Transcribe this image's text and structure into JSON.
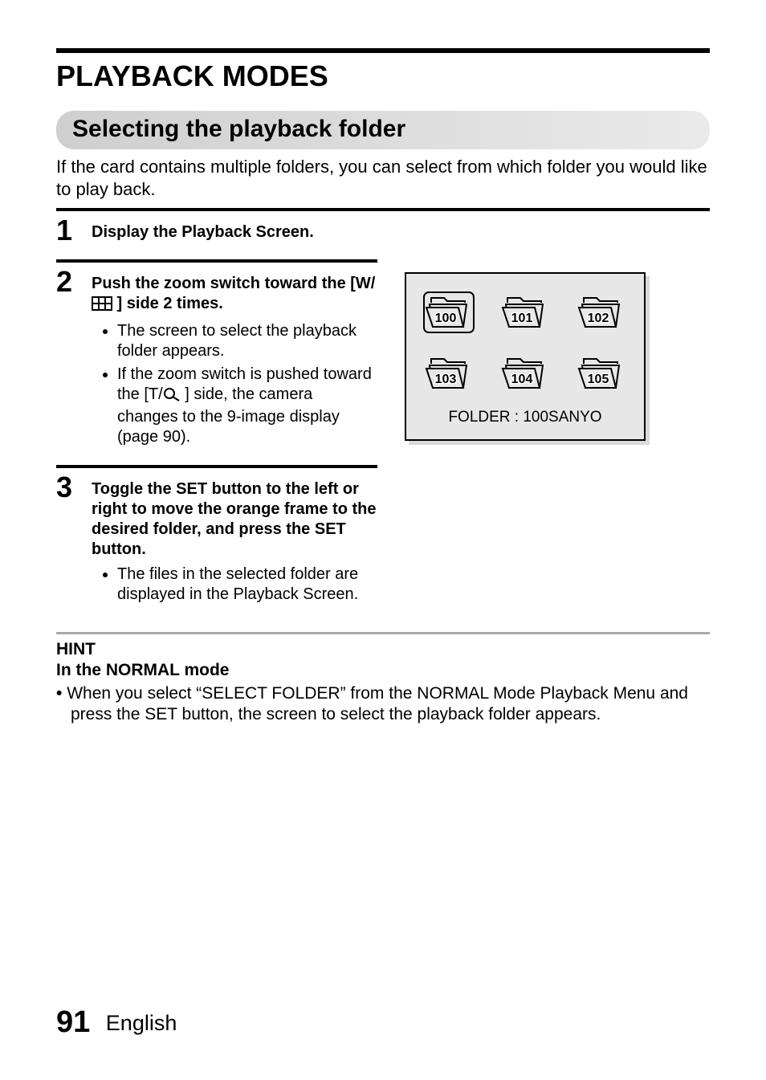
{
  "title": "PLAYBACK MODES",
  "section_heading": "Selecting the playback folder",
  "intro": "If the card contains multiple folders, you can select from which folder you would like to play back.",
  "steps": [
    {
      "num": "1",
      "head": "Display the Playback Screen."
    },
    {
      "num": "2",
      "head_pre": "Push the zoom switch toward the [W/",
      "head_post": " ] side 2 times.",
      "bullets": [
        "The screen to select the playback folder appears.",
        ""
      ],
      "bullet2_pre": "If the zoom switch is pushed toward the [T/",
      "bullet2_post": " ] side, the camera changes to the 9-image display (page 90)."
    },
    {
      "num": "3",
      "head": "Toggle the SET button to the left or right to move the orange frame to the desired folder, and press the SET button.",
      "bullets": [
        "The files in the selected folder are displayed in the Playback Screen."
      ]
    }
  ],
  "figure": {
    "folders": [
      "100",
      "101",
      "102",
      "103",
      "104",
      "105"
    ],
    "selected_index": 0,
    "caption": "FOLDER : 100SANYO"
  },
  "hint": {
    "title": "HINT",
    "subtitle": "In the NORMAL mode",
    "bullet": "When you select “SELECT FOLDER” from the NORMAL Mode Playback Menu and press the SET button, the screen to select the playback folder appears."
  },
  "footer": {
    "page": "91",
    "lang": "English"
  }
}
